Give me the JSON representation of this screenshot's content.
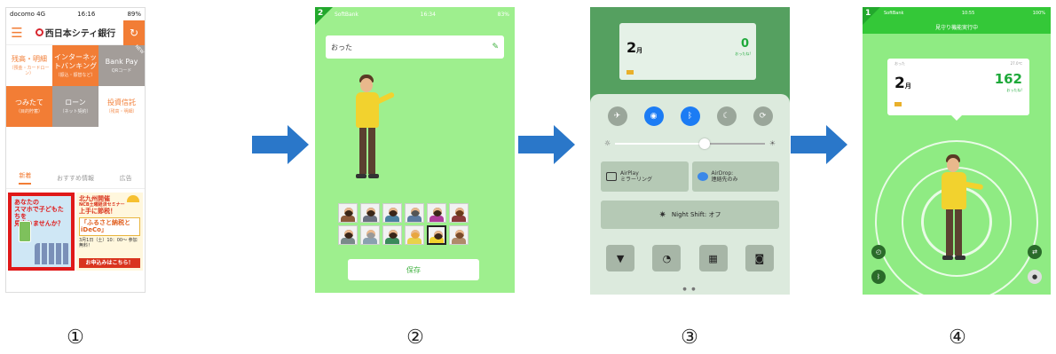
{
  "captions": [
    "①",
    "②",
    "③",
    "④"
  ],
  "colors": {
    "arrow": "#2a77c9",
    "bank_orange": "#f27d35",
    "app_green": "#34c838"
  },
  "screen1": {
    "status": {
      "carrier": "docomo 4G",
      "time": "16:16",
      "battery": "89%"
    },
    "logo": "西日本シティ銀行",
    "tiles": [
      {
        "label": "残高・明細",
        "sub": "（預金・カードローン）"
      },
      {
        "label": "インターネットバンキング",
        "sub": "（振込・振替など）"
      },
      {
        "label": "Bank Pay",
        "sub": "QRコード"
      },
      {
        "label": "つみたて",
        "sub": "（目的貯蓄）"
      },
      {
        "label": "ローン",
        "sub": "（ネット契約）"
      },
      {
        "label": "投資信託",
        "sub": "（残高・明細）"
      }
    ],
    "badge_new": "NEW",
    "tabs": [
      "新着",
      "おすすめ情報",
      "広告"
    ],
    "banner_left": {
      "text1": "あなたの",
      "text2": "スマホで子どもたちを",
      "text3": "見守りませんか？"
    },
    "banner_right": {
      "line1": "北九州開催",
      "line2": "NCB土曜経済セミナー",
      "line3": "上手に節税！",
      "line4": "「ふるさと納税とiDeCo」",
      "date": "3月1日（土）10：00〜 参加無料！",
      "apply": "お申込みはこちら！"
    }
  },
  "screen2": {
    "step": "2",
    "status": {
      "carrier": "SoftBank",
      "time": "16:34",
      "battery": "83%"
    },
    "name_value": "おった",
    "save_label": "保存",
    "avatars": [
      {
        "hair": "#3a2618",
        "shirt": "#8a5a3a"
      },
      {
        "hair": "#3a2618",
        "shirt": "#6a7080"
      },
      {
        "hair": "#3a2618",
        "shirt": "#4a80a0"
      },
      {
        "hair": "#555555",
        "shirt": "#5a7aa0"
      },
      {
        "hair": "#3a2618",
        "shirt": "#b03a9a"
      },
      {
        "hair": "#6a3a1a",
        "shirt": "#8a3a3a"
      },
      {
        "hair": "#3a2618",
        "shirt": "#7a8a8a"
      },
      {
        "hair": "#999999",
        "shirt": "#8aa0b0"
      },
      {
        "hair": "#3a2618",
        "shirt": "#3a8a5a"
      },
      {
        "hair": "#e8a640",
        "shirt": "#e8d24a"
      },
      {
        "hair": "#3a2618",
        "shirt": "#f2d22e"
      },
      {
        "hair": "#7a4a2a",
        "shirt": "#b08a6a"
      }
    ],
    "selected_avatar": 10
  },
  "screen3": {
    "widget": {
      "month": "2",
      "month_unit": "月",
      "count": "0",
      "count_label": "おったね!"
    },
    "airplay": {
      "line1": "AirPlay",
      "line2": "ミラーリング"
    },
    "airdrop": {
      "line1": "AirDrop:",
      "line2": "連絡先のみ"
    },
    "night_shift": "Night Shift: オフ",
    "brightness": 0.6
  },
  "screen4": {
    "step": "1",
    "status": {
      "carrier": "SoftBank",
      "time": "10:55",
      "battery": "100%"
    },
    "title": "見守り機能実行中",
    "card": {
      "label": "おった",
      "temp": "27.0℃",
      "month": "2",
      "month_unit": "月",
      "count": "162",
      "count_label": "おったね!"
    }
  }
}
